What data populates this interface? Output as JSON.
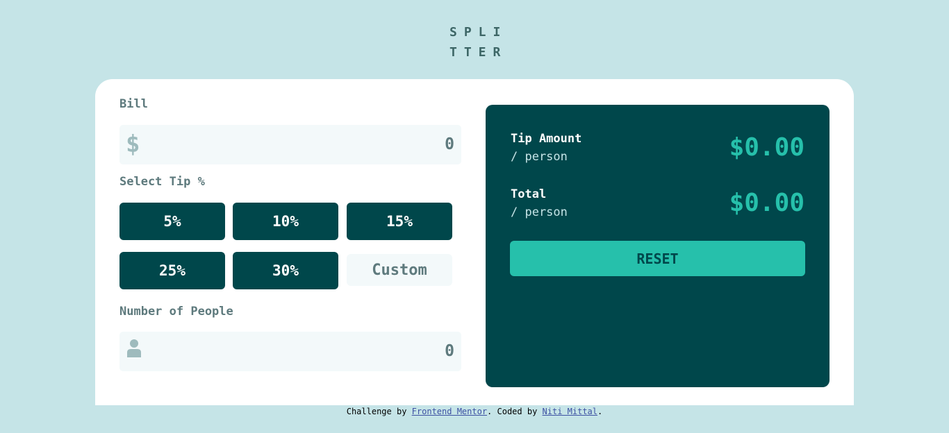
{
  "logo": {
    "line1": "SPLI",
    "line2": "TTER"
  },
  "bill": {
    "label": "Bill",
    "icon": "dollar-icon",
    "value": "0"
  },
  "tip": {
    "label": "Select Tip %",
    "options": [
      "5%",
      "10%",
      "15%",
      "25%",
      "30%"
    ],
    "custom_placeholder": "Custom"
  },
  "people": {
    "label": "Number of People",
    "icon": "person-icon",
    "value": "0"
  },
  "results": {
    "tip_label": "Tip Amount",
    "tip_sub": "/ person",
    "tip_value": "$0.00",
    "total_label": "Total",
    "total_sub": "/ person",
    "total_value": "$0.00",
    "reset_label": "RESET"
  },
  "footer": {
    "prefix": "Challenge by",
    "link1": "Frontend Mentor",
    "middle": ". Coded by",
    "link2": "Niti Mittal",
    "suffix": "."
  },
  "colors": {
    "background": "#c5e4e7",
    "dark_cyan": "#00474b",
    "accent": "#26c0ab",
    "input_bg": "#f3f9fa"
  }
}
